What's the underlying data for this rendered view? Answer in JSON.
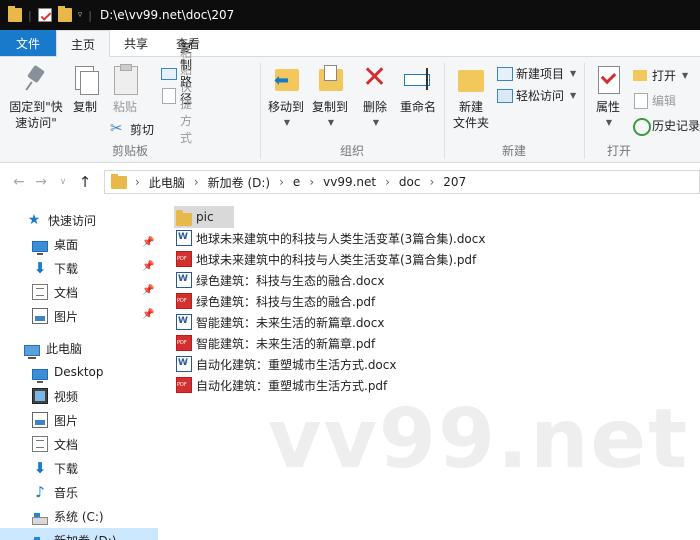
{
  "titlebar": {
    "path": "D:\\e\\vv99.net\\doc\\207"
  },
  "tabs": [
    {
      "label": "文件"
    },
    {
      "label": "主页"
    },
    {
      "label": "共享"
    },
    {
      "label": "查看"
    }
  ],
  "ribbon": {
    "clipboard": {
      "group_label": "剪贴板",
      "pin_line1": "固定到\"快",
      "pin_line2": "速访问\"",
      "copy": "复制",
      "paste": "粘贴",
      "copy_path": "复制路径",
      "paste_shortcut": "粘贴快捷方式",
      "cut": "剪切"
    },
    "organize": {
      "group_label": "组织",
      "move_to": "移动到",
      "copy_to": "复制到",
      "delete": "删除",
      "rename": "重命名"
    },
    "new": {
      "group_label": "新建",
      "new_folder_line1": "新建",
      "new_folder_line2": "文件夹",
      "new_item": "新建项目",
      "easy_access": "轻松访问"
    },
    "open": {
      "group_label": "打开",
      "properties": "属性",
      "open": "打开",
      "edit": "编辑",
      "history": "历史记录"
    }
  },
  "address": {
    "crumbs": [
      "此电脑",
      "新加卷 (D:)",
      "e",
      "vv99.net",
      "doc",
      "207"
    ]
  },
  "nav": {
    "quick_access": "快速访问",
    "quick_items": [
      "桌面",
      "下载",
      "文档",
      "图片"
    ],
    "this_pc": "此电脑",
    "pc_items": [
      "Desktop",
      "视频",
      "图片",
      "文档",
      "下载",
      "音乐",
      "系统 (C:)",
      "新加卷 (D:)"
    ]
  },
  "files": [
    {
      "name": "pic",
      "type": "folder"
    },
    {
      "name": "地球未来建筑中的科技与人类生活变革(3篇合集).docx",
      "type": "docx"
    },
    {
      "name": "地球未来建筑中的科技与人类生活变革(3篇合集).pdf",
      "type": "pdf"
    },
    {
      "name": "绿色建筑：科技与生态的融合.docx",
      "type": "docx"
    },
    {
      "name": "绿色建筑：科技与生态的融合.pdf",
      "type": "pdf"
    },
    {
      "name": "智能建筑：未来生活的新篇章.docx",
      "type": "docx"
    },
    {
      "name": "智能建筑：未来生活的新篇章.pdf",
      "type": "pdf"
    },
    {
      "name": "自动化建筑：重塑城市生活方式.docx",
      "type": "docx"
    },
    {
      "name": "自动化建筑：重塑城市生活方式.pdf",
      "type": "pdf"
    }
  ],
  "watermark": "vv99.net",
  "colors": {
    "file_tab": "#1979ca",
    "folder": "#e8b84a",
    "selected_nav": "#cce8ff",
    "selected_file": "#d9d9d9"
  }
}
